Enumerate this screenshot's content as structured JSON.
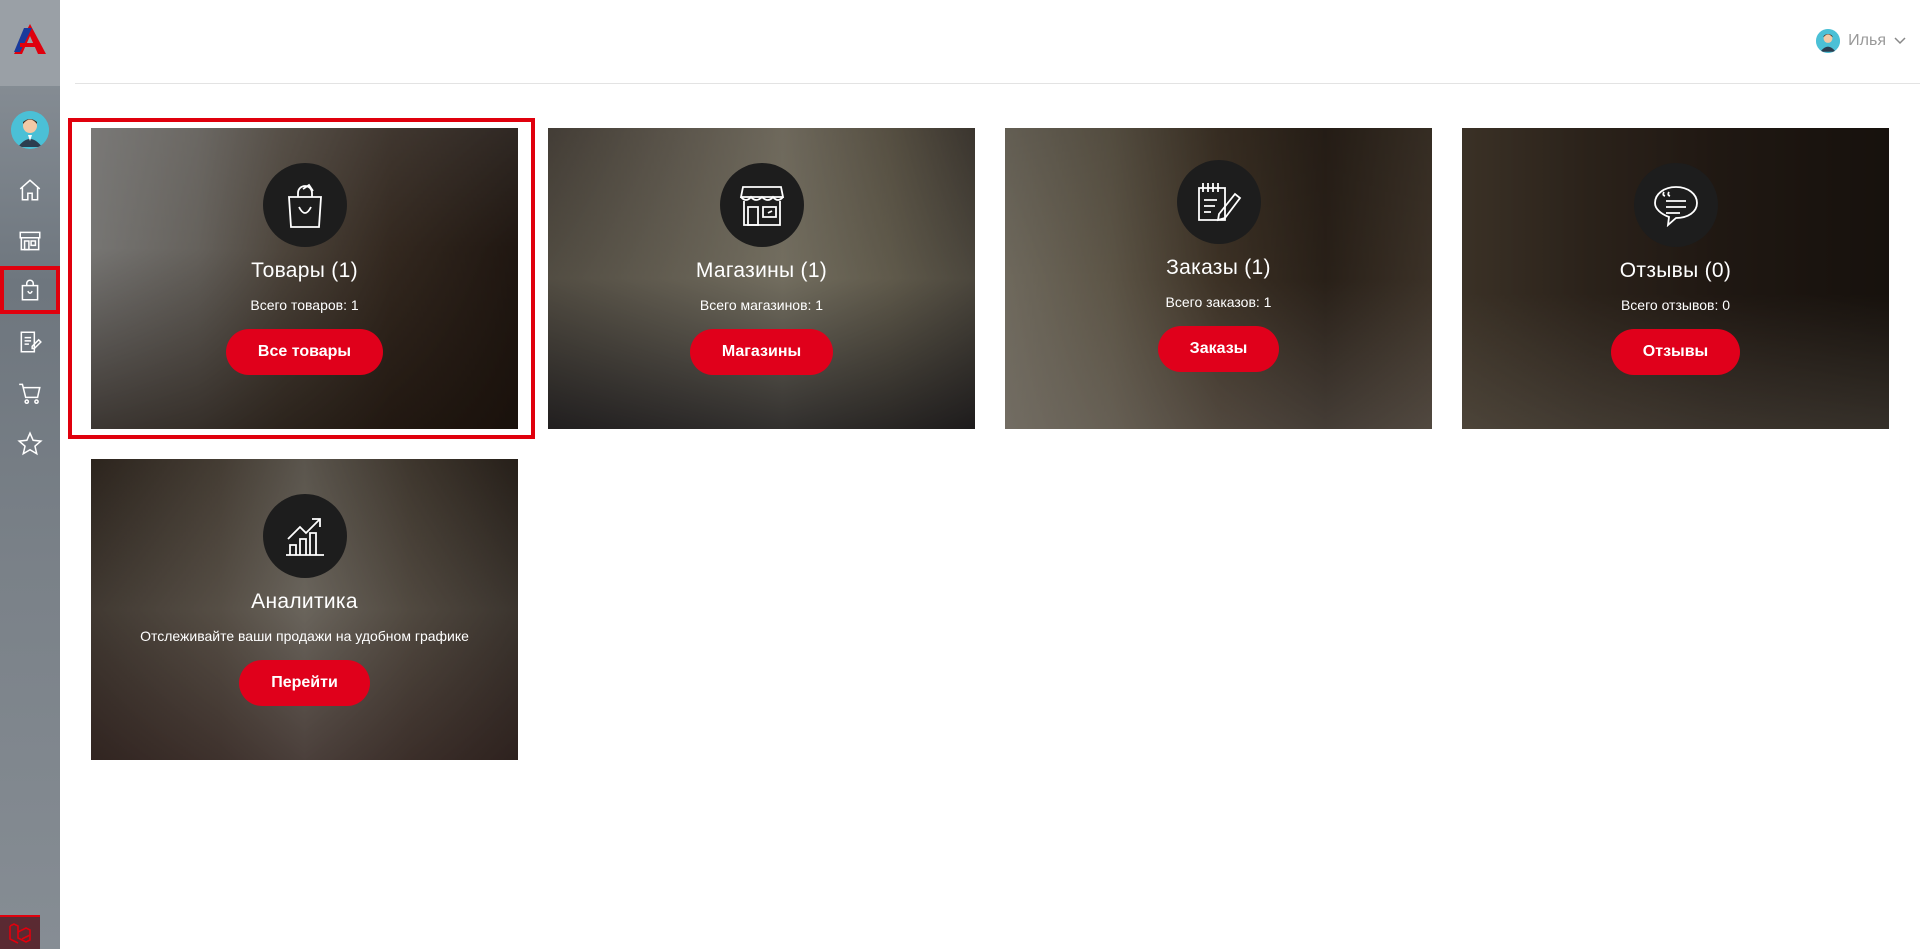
{
  "header": {
    "user_name": "Илья"
  },
  "sidebar": {
    "items": [
      {
        "name": "home-icon"
      },
      {
        "name": "store-icon"
      },
      {
        "name": "shopping-bag-icon",
        "active": true
      },
      {
        "name": "edit-note-icon"
      },
      {
        "name": "cart-icon"
      },
      {
        "name": "star-icon"
      }
    ]
  },
  "cards": [
    {
      "title": "Товары (1)",
      "subtitle": "Всего товаров: 1",
      "button": "Все товары",
      "icon": "shopping-bag-icon"
    },
    {
      "title": "Магазины (1)",
      "subtitle": "Всего магазинов: 1",
      "button": "Магазины",
      "icon": "store-icon"
    },
    {
      "title": "Заказы (1)",
      "subtitle": "Всего заказов: 1",
      "button": "Заказы",
      "icon": "order-edit-icon"
    },
    {
      "title": "Отзывы (0)",
      "subtitle": "Всего отзывов: 0",
      "button": "Отзывы",
      "icon": "chat-bubble-icon"
    },
    {
      "title": "Аналитика",
      "subtitle": "Отслеживайте ваши продажи на удобном графике",
      "button": "Перейти",
      "icon": "chart-growth-icon"
    }
  ],
  "colors": {
    "accent": "#e0001b",
    "highlight": "#e0000d"
  }
}
